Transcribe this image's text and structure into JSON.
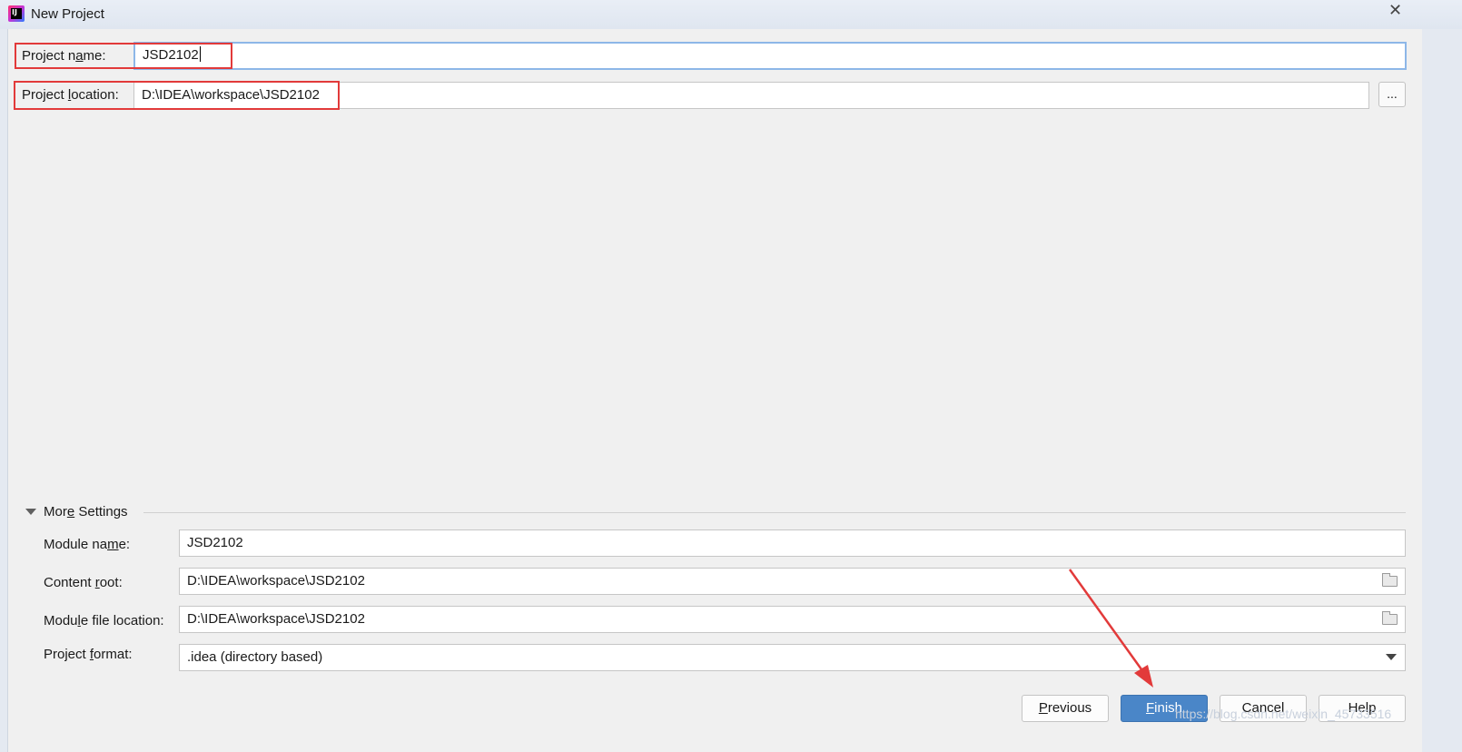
{
  "window": {
    "title": "New Project",
    "close_glyph": "✕",
    "app_icon": "intellij-idea-icon",
    "icon_text": "IJ"
  },
  "project": {
    "name_label_pre": "Project n",
    "name_label_key": "a",
    "name_label_post": "me:",
    "name_value": "JSD2102",
    "location_label_pre": "Project ",
    "location_label_key": "l",
    "location_label_post": "ocation:",
    "location_value": "D:\\IDEA\\workspace\\JSD2102",
    "browse_label": "..."
  },
  "more_settings": {
    "title_pre": "Mor",
    "title_key": "e",
    "title_post": " Settings",
    "expanded": true,
    "module_name_label_pre": "Module na",
    "module_name_label_key": "m",
    "module_name_label_post": "e:",
    "module_name_value": "JSD2102",
    "content_root_label_pre": "Content ",
    "content_root_label_key": "r",
    "content_root_label_post": "oot:",
    "content_root_value": "D:\\IDEA\\workspace\\JSD2102",
    "module_file_label_pre": "Modu",
    "module_file_label_key": "l",
    "module_file_label_post": "e file location:",
    "module_file_value": "D:\\IDEA\\workspace\\JSD2102",
    "project_format_label_pre": "Project ",
    "project_format_label_key": "f",
    "project_format_label_post": "ormat:",
    "project_format_value": ".idea (directory based)"
  },
  "buttons": {
    "previous_key": "P",
    "previous_rest": "revious",
    "finish_key": "F",
    "finish_rest": "inish",
    "cancel": "Cancel",
    "help": "Help"
  },
  "watermark": "https://blog.csdn.net/weixin_45733516",
  "colors": {
    "accent": "#4a86c8",
    "highlight_box": "#e23a3a",
    "focus_border": "#8db7e8",
    "background": "#f0f0f0"
  }
}
